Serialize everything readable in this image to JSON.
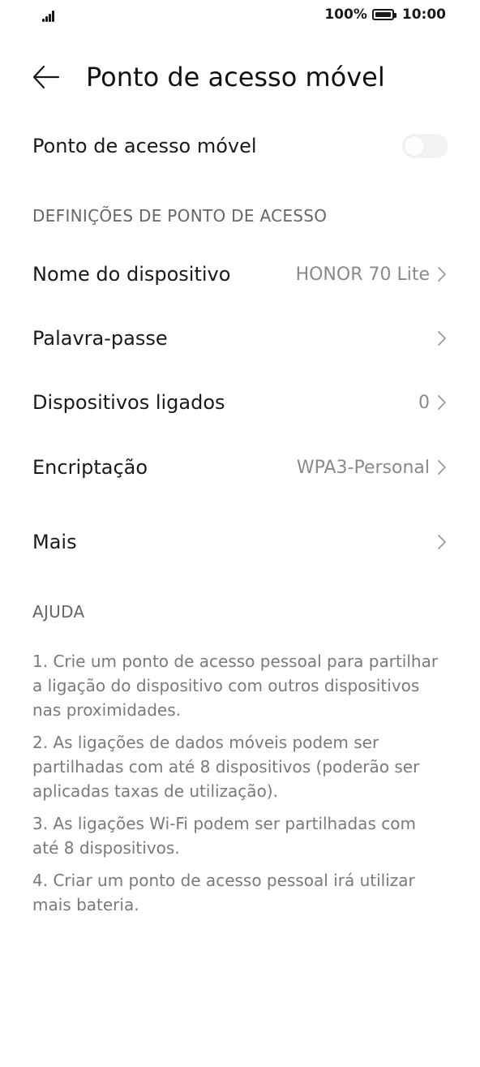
{
  "status_bar": {
    "battery_percent": "100%",
    "time": "10:00",
    "icons": [
      "signal-icon",
      "battery-icon"
    ]
  },
  "header": {
    "title": "Ponto de acesso móvel",
    "back_icon": "arrow-left-icon"
  },
  "hotspot_toggle": {
    "label": "Ponto de acesso móvel",
    "enabled": false
  },
  "settings_section": {
    "header": "DEFINIÇÕES DE PONTO DE ACESSO",
    "items": [
      {
        "label": "Nome do dispositivo",
        "value": "HONOR 70 Lite"
      },
      {
        "label": "Palavra-passe",
        "value": ""
      },
      {
        "label": "Dispositivos ligados",
        "value": "0"
      },
      {
        "label": "Encriptação",
        "value": "WPA3-Personal"
      },
      {
        "label": "Mais",
        "value": ""
      }
    ]
  },
  "help_section": {
    "header": "AJUDA",
    "items": [
      "1. Crie um ponto de acesso pessoal para partilhar a ligação do dispositivo com outros dispositivos nas proximidades.",
      "2. As ligações de dados móveis podem ser partilhadas com até 8 dispositivos (poderão ser aplicadas taxas de utilização).",
      "3. As ligações Wi-Fi podem ser partilhadas com até 8 dispositivos.",
      "4. Criar um ponto de acesso pessoal irá utilizar mais bateria."
    ]
  },
  "colors": {
    "text_primary": "#1a1a1a",
    "text_secondary": "#8a8a8a",
    "toggle_off": "#f2f2f2"
  }
}
